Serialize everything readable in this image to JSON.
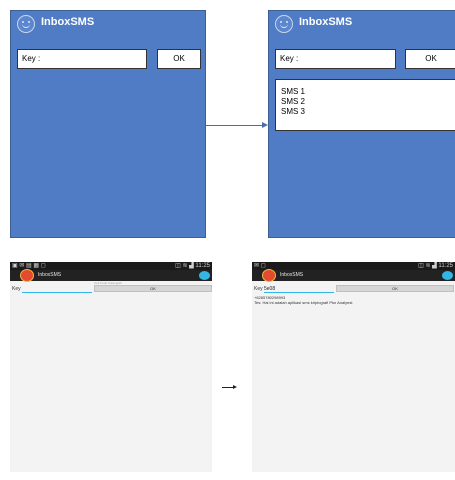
{
  "mockups": {
    "before": {
      "app_title": "InboxSMS",
      "key_label": "Key :",
      "ok_label": "OK"
    },
    "after": {
      "app_title": "InboxSMS",
      "key_label": "Key :",
      "ok_label": "OK",
      "sms_list": [
        "SMS 1",
        "SMS 2",
        "SMS 3"
      ]
    }
  },
  "screenshots": {
    "before": {
      "status_left": "▣ ✉ ▤ ▦ ◻",
      "status_right": "◫ ≋ ▟ 11:25",
      "app_title": "InboxSMS",
      "hint": "Cek Kode Kriptografi",
      "key_label": "Key",
      "key_value": "",
      "ok_label": "OK"
    },
    "after": {
      "status_left": "✉ ◻",
      "status_right": "◫ ≋ ▟ 11:25",
      "app_title": "InboxSMS",
      "hint": "",
      "key_label": "Key",
      "key_value": "5e08",
      "ok_label": "OK",
      "message_sender": "+6285780298993",
      "message_text": "Tes: Hai ini adalah aplikasi sms kriptografi Pkn Analyest"
    }
  },
  "colors": {
    "mock_bg": "#4f7cc4",
    "arrow": "#4a6fa8",
    "accent": "#33b5e5",
    "app_icon": "#e24b2e"
  }
}
